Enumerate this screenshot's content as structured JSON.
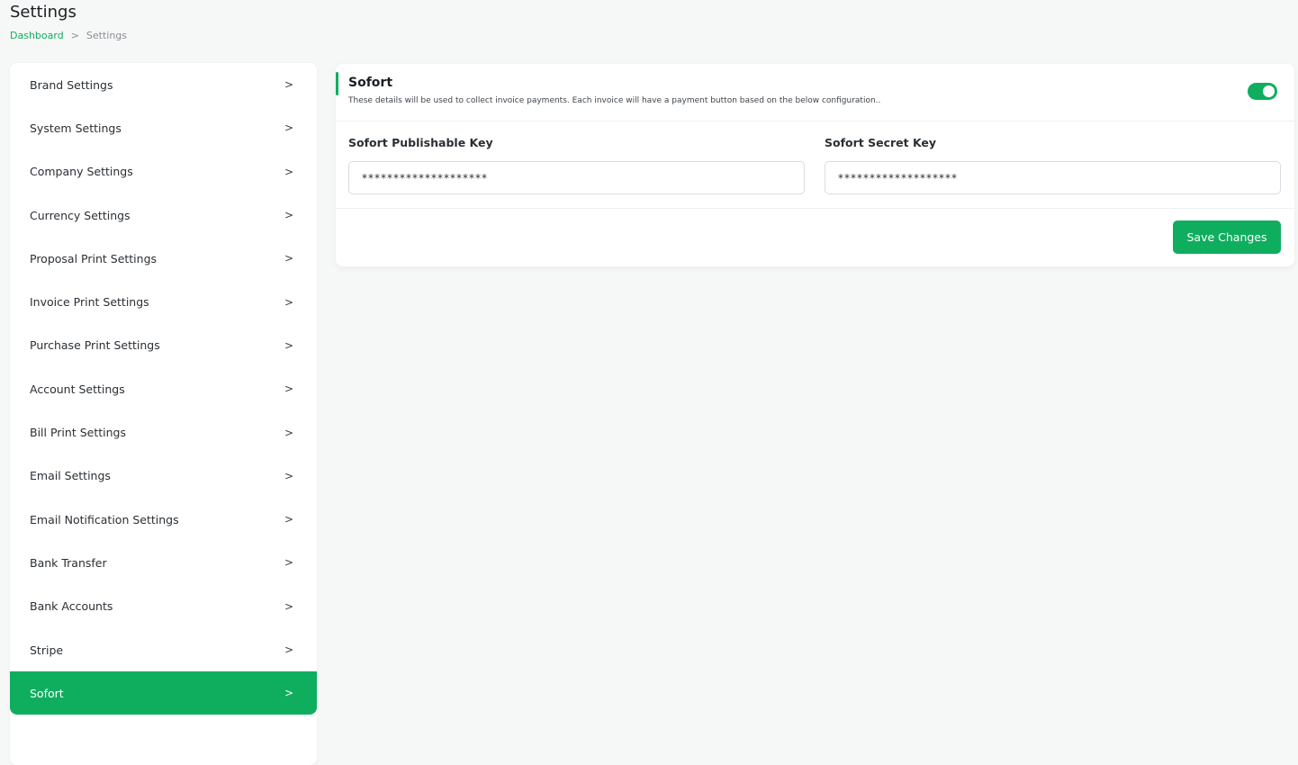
{
  "header": {
    "title": "Settings",
    "breadcrumb": {
      "home": "Dashboard",
      "separator": ">",
      "current": "Settings"
    }
  },
  "sidebar": {
    "items": [
      {
        "label": "Brand Settings"
      },
      {
        "label": "System Settings"
      },
      {
        "label": "Company Settings"
      },
      {
        "label": "Currency Settings"
      },
      {
        "label": "Proposal Print Settings"
      },
      {
        "label": "Invoice Print Settings"
      },
      {
        "label": "Purchase Print Settings"
      },
      {
        "label": "Account Settings"
      },
      {
        "label": "Bill Print Settings"
      },
      {
        "label": "Email Settings"
      },
      {
        "label": "Email Notification Settings"
      },
      {
        "label": "Bank Transfer"
      },
      {
        "label": "Bank Accounts"
      },
      {
        "label": "Stripe"
      },
      {
        "label": "Sofort"
      }
    ],
    "active_index": 14,
    "chevron": ">"
  },
  "card": {
    "title": "Sofort",
    "description": "These details will be used to collect invoice payments. Each invoice will have a payment button based on the below configuration..",
    "enabled": true,
    "fields": {
      "publishable_key": {
        "label": "Sofort Publishable Key",
        "value": "********************"
      },
      "secret_key": {
        "label": "Sofort Secret Key",
        "value": "*******************"
      }
    },
    "save_label": "Save Changes"
  },
  "colors": {
    "accent": "#0fae5f",
    "background": "#f6f7f7"
  }
}
